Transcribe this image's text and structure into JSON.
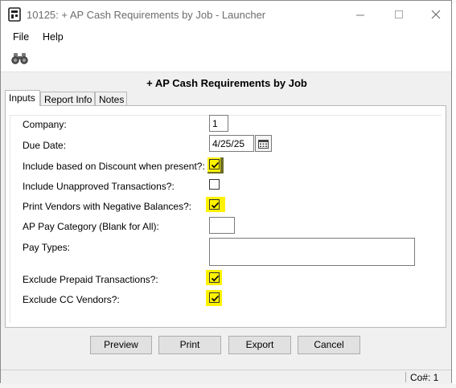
{
  "window": {
    "title": "10125: + AP Cash Requirements by Job - Launcher",
    "controls": [
      "minimize-icon",
      "maximize-icon",
      "close-icon"
    ]
  },
  "menu": {
    "file": "File",
    "help": "Help"
  },
  "toolbar": {
    "find_icon": "binoculars-icon"
  },
  "report": {
    "title": "+ AP Cash Requirements by Job"
  },
  "tabs": [
    {
      "label": "Inputs",
      "active": true
    },
    {
      "label": "Report Info",
      "active": false
    },
    {
      "label": "Notes",
      "active": false
    }
  ],
  "inputs": {
    "company": {
      "label": "Company:",
      "value": "1"
    },
    "due_date": {
      "label": "Due Date:",
      "value": "4/25/25"
    },
    "include_discount": {
      "label": "Include based on Discount when present?:",
      "checked": true
    },
    "include_unapproved": {
      "label": "Include Unapproved Transactions?:",
      "checked": false
    },
    "print_negative": {
      "label": "Print Vendors with Negative Balances?:",
      "checked": true
    },
    "ap_pay_category": {
      "label": "AP Pay Category (Blank for All):",
      "value": ""
    },
    "pay_types": {
      "label": "Pay Types:",
      "value": ""
    },
    "exclude_prepaid": {
      "label": "Exclude Prepaid Transactions?:",
      "checked": true
    },
    "exclude_cc": {
      "label": "Exclude CC Vendors?:",
      "checked": true
    }
  },
  "buttons": {
    "preview": "Preview",
    "print": "Print",
    "export": "Export",
    "cancel": "Cancel"
  },
  "status": {
    "company": "Co#: 1"
  },
  "colors": {
    "highlight": "#fff200",
    "window_bg": "#f0f0f0"
  }
}
